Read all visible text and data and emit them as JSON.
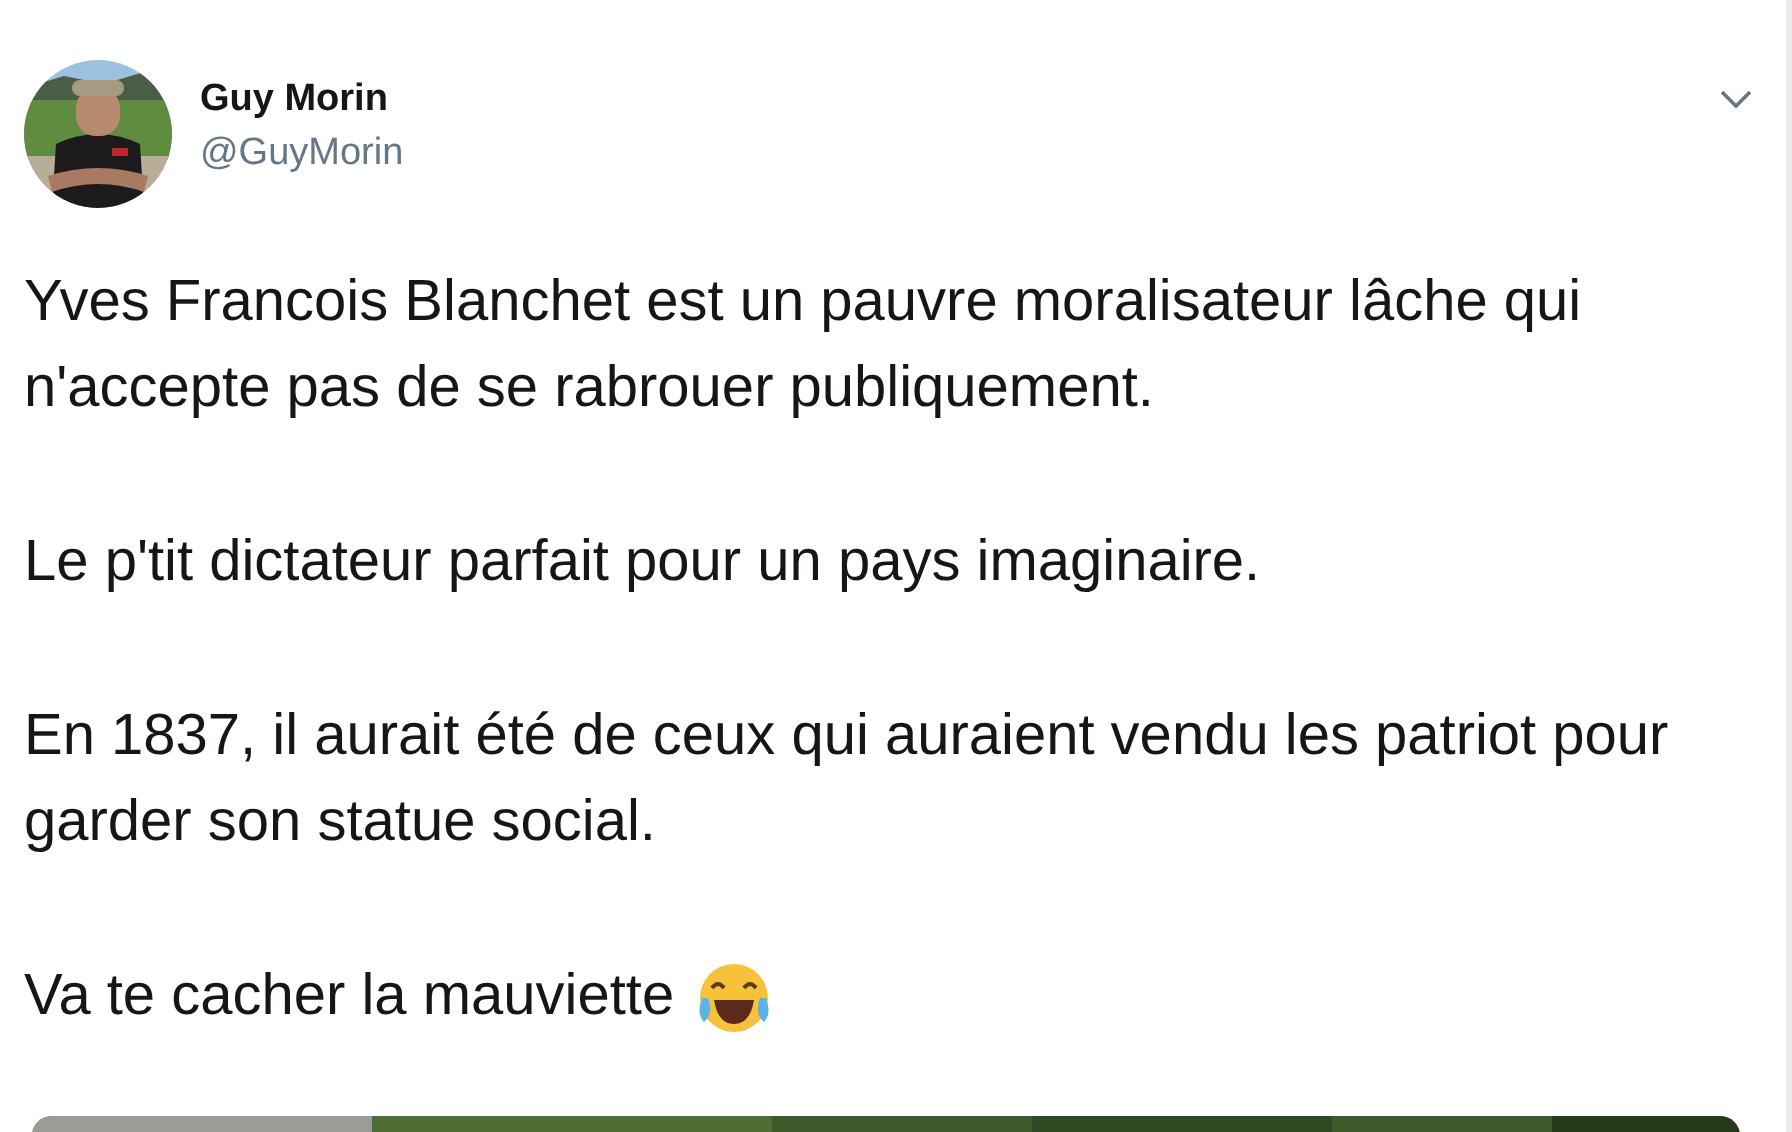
{
  "author": {
    "name": "Guy Morin",
    "handle": "@GuyMorin"
  },
  "paragraphs": [
    "Yves Francois Blanchet est un pauvre moralisateur lâche qui n'accepte pas de se rabrouer publiquement.",
    "Le p'tit dictateur parfait pour un pays imaginaire.",
    "En 1837, il aurait été de ceux qui auraient vendu les patriot pour garder son statue social.",
    "Va te cacher la mauviette"
  ]
}
